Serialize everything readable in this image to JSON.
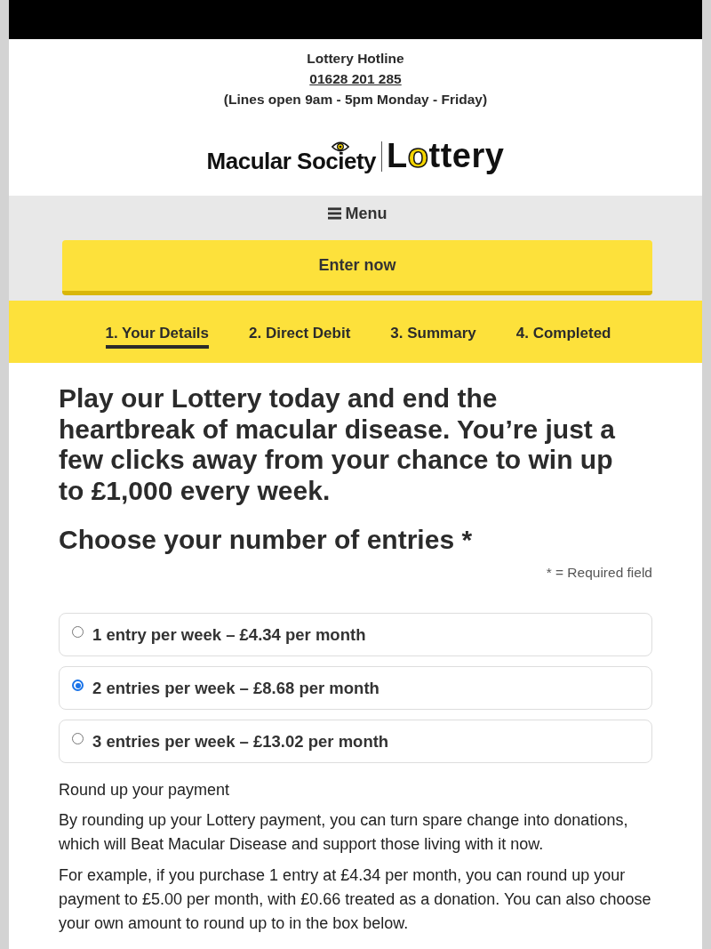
{
  "hotline": {
    "title": "Lottery Hotline",
    "phone": "01628 201 285",
    "hours": "(Lines open 9am - 5pm Monday - Friday)"
  },
  "logo": {
    "organisation": "Macular Society",
    "product": "Lottery"
  },
  "menu": {
    "label": "Menu"
  },
  "cta": {
    "label": "Enter now"
  },
  "steps": [
    {
      "label": "1. Your Details",
      "selected": true
    },
    {
      "label": "2. Direct Debit",
      "selected": false
    },
    {
      "label": "3. Summary",
      "selected": false
    },
    {
      "label": "4. Completed",
      "selected": false
    }
  ],
  "intro": "Play our Lottery today and end the heartbreak of macular disease. You’re just a few clicks away from your chance to win up to £1,000 every week.",
  "entries": {
    "heading": "Choose your number of entries *",
    "required_note": "* = Required field",
    "options": [
      {
        "label": "1 entry per week – £4.34 per month",
        "selected": false
      },
      {
        "label": "2 entries per week – £8.68 per month",
        "selected": true
      },
      {
        "label": "3 entries per week – £13.02 per month",
        "selected": false
      }
    ]
  },
  "round_up": {
    "heading": "Round up your payment",
    "paragraphs": [
      "By rounding up your Lottery payment, you can turn spare change into donations, which will Beat Macular Disease and support those living with it now.",
      "For example, if you purchase 1 entry at £4.34 per month, you can round up your payment to £5.00 per month, with £0.66 treated as a donation. You can also choose your own amount to round up to in the box below."
    ]
  }
}
